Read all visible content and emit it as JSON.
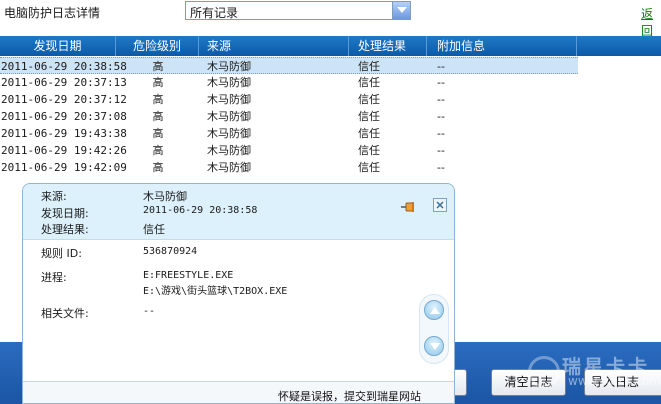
{
  "header": {
    "title": "电脑防护日志详情",
    "filter_value": "所有记录",
    "back_label": "返回"
  },
  "table": {
    "columns": [
      "发现日期",
      "危险级别",
      "来源",
      "处理结果",
      "附加信息"
    ],
    "rows": [
      {
        "date": "2011-06-29 20:38:58",
        "level": "高",
        "source": "木马防御",
        "result": "信任",
        "extra": "--"
      },
      {
        "date": "2011-06-29 20:37:13",
        "level": "高",
        "source": "木马防御",
        "result": "信任",
        "extra": "--"
      },
      {
        "date": "2011-06-29 20:37:12",
        "level": "高",
        "source": "木马防御",
        "result": "信任",
        "extra": "--"
      },
      {
        "date": "2011-06-29 20:37:08",
        "level": "高",
        "source": "木马防御",
        "result": "信任",
        "extra": "--"
      },
      {
        "date": "2011-06-29 19:43:38",
        "level": "高",
        "source": "木马防御",
        "result": "信任",
        "extra": "--"
      },
      {
        "date": "2011-06-29 19:42:26",
        "level": "高",
        "source": "木马防御",
        "result": "信任",
        "extra": "--"
      },
      {
        "date": "2011-06-29 19:42:09",
        "level": "高",
        "source": "木马防御",
        "result": "信任",
        "extra": "--"
      }
    ]
  },
  "detail": {
    "source_label": "来源:",
    "source_value": "木马防御",
    "date_label": "发现日期:",
    "date_value": "2011-06-29 20:38:58",
    "result_label": "处理结果:",
    "result_value": "信任",
    "rule_label": "规则 ID:",
    "rule_value": "536870924",
    "process_label": "进程:",
    "process_value_1": "E:FREESTYLE.EXE",
    "process_value_2": "E:\\游戏\\街头篮球\\T2BOX.EXE",
    "files_label": "相关文件:",
    "files_value": "--",
    "report_link": "怀疑是误报，提交到瑞星网站"
  },
  "footer": {
    "clear_log": "清空日志",
    "import_log": "导入日志"
  },
  "watermark": {
    "brand": "瑞星卡卡",
    "url": "www.ikaka.com"
  },
  "icons": {
    "filter_dropdown": "chevron-down-icon",
    "pin": "pin-icon",
    "close": "close-icon",
    "scroll_up": "arrow-up-icon",
    "scroll_down": "arrow-down-icon"
  },
  "colors": {
    "header_blue": "#0c5aa8",
    "selected_row": "#cde4f7",
    "popup_head": "#dcf1fb",
    "back_link": "#0a7d12"
  }
}
